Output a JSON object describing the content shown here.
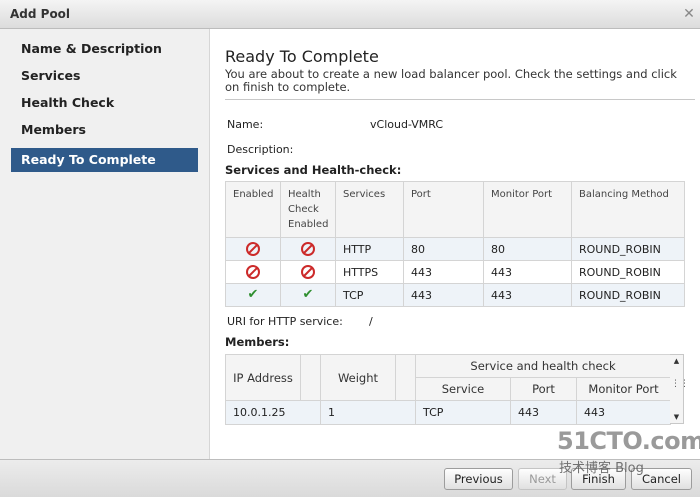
{
  "window": {
    "title": "Add Pool",
    "close_glyph": "✕"
  },
  "sidebar": {
    "items": [
      {
        "label": "Name & Description",
        "active": false
      },
      {
        "label": "Services",
        "active": false
      },
      {
        "label": "Health Check",
        "active": false
      },
      {
        "label": "Members",
        "active": false
      },
      {
        "label": "Ready To Complete",
        "active": true
      }
    ]
  },
  "main": {
    "heading": "Ready To Complete",
    "intro": "You are about to create a new load balancer pool. Check the settings and click on finish to complete.",
    "name_label": "Name:",
    "name_value": "vCloud-VMRC",
    "description_label": "Description:",
    "services_section": "Services and Health-check:",
    "services_table": {
      "headers": [
        "Enabled",
        "Health Check Enabled",
        "Services",
        "Port",
        "Monitor Port",
        "Balancing Method"
      ],
      "rows": [
        {
          "enabled": "disabled-icon",
          "health_check": "disabled-icon",
          "service": "HTTP",
          "port": "80",
          "monitor_port": "80",
          "method": "ROUND_ROBIN"
        },
        {
          "enabled": "disabled-icon",
          "health_check": "disabled-icon",
          "service": "HTTPS",
          "port": "443",
          "monitor_port": "443",
          "method": "ROUND_ROBIN"
        },
        {
          "enabled": "check-icon",
          "health_check": "check-icon",
          "service": "TCP",
          "port": "443",
          "monitor_port": "443",
          "method": "ROUND_ROBIN"
        }
      ]
    },
    "uri_label": "URI for HTTP service:",
    "uri_value": "/",
    "members_section": "Members:",
    "members_table": {
      "headers": {
        "ip": "IP Address",
        "weight": "Weight",
        "group": "Service and health check",
        "service": "Service",
        "port": "Port",
        "monitor_port": "Monitor Port"
      },
      "rows": [
        {
          "ip": "10.0.1.25",
          "weight": "1",
          "service": "TCP",
          "port": "443",
          "monitor_port": "443"
        }
      ]
    }
  },
  "footer": {
    "previous": "Previous",
    "next": "Next",
    "finish": "Finish",
    "cancel": "Cancel"
  },
  "watermark": {
    "line1": "51CTO.com",
    "line2": "技术博客  Blog"
  },
  "colors": {
    "active_nav": "#2f5a8a",
    "error_red": "#cc2a2a",
    "ok_green": "#2f8f2f",
    "row_stripe": "#eef3f8"
  }
}
